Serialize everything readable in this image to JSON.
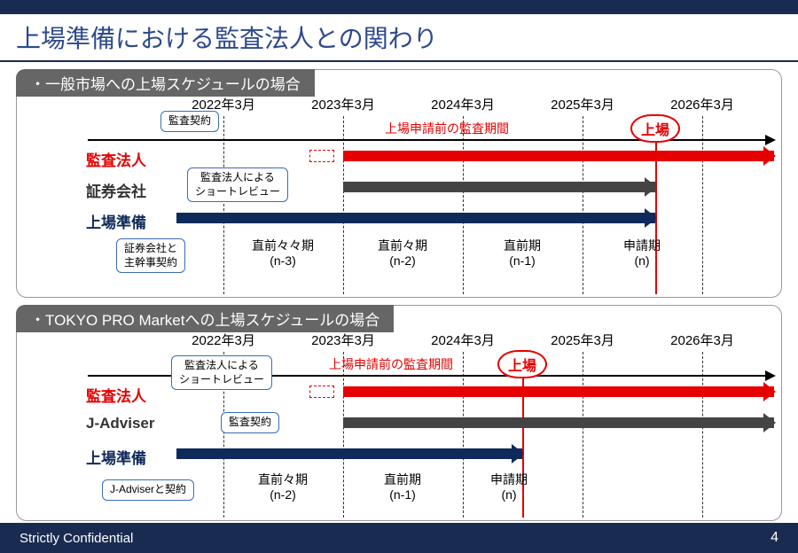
{
  "slide": {
    "title": "上場準備における監査法人との関わり"
  },
  "panel1": {
    "header": "・一般市場への上場スケジュールの場合",
    "years": [
      "2022年3月",
      "2023年3月",
      "2024年3月",
      "2025年3月",
      "2026年3月"
    ],
    "rows": {
      "r1": "監査法人",
      "r2": "証券会社",
      "r3": "上場準備"
    },
    "periods": [
      {
        "top": "直前々々期",
        "bot": "(n-3)"
      },
      {
        "top": "直前々期",
        "bot": "(n-2)"
      },
      {
        "top": "直前期",
        "bot": "(n-1)"
      },
      {
        "top": "申請期",
        "bot": "(n)"
      }
    ],
    "note": "上場申請前の監査期間",
    "listing": "上場",
    "callouts": {
      "c1": "監査契約",
      "c2": "監査法人による\nショートレビュー",
      "c3": "証券会社と\n主幹事契約"
    }
  },
  "panel2": {
    "header": "・TOKYO PRO Marketへの上場スケジュールの場合",
    "years": [
      "2022年3月",
      "2023年3月",
      "2024年3月",
      "2025年3月",
      "2026年3月"
    ],
    "rows": {
      "r1": "監査法人",
      "r2": "J-Adviser",
      "r3": "上場準備"
    },
    "periods": [
      {
        "top": "直前々期",
        "bot": "(n-2)"
      },
      {
        "top": "直前期",
        "bot": "(n-1)"
      },
      {
        "top": "申請期",
        "bot": "(n)"
      }
    ],
    "note": "上場申請前の監査期間",
    "listing": "上場",
    "callouts": {
      "c1": "監査法人による\nショートレビュー",
      "c2": "監査契約",
      "c3": "J-Adviserと契約"
    }
  },
  "footer": {
    "conf": "Strictly Confidential",
    "page": "4"
  },
  "chart_data": [
    {
      "type": "timeline",
      "title": "一般市場への上場スケジュールの場合",
      "x_ticks": [
        "2022年3月",
        "2023年3月",
        "2024年3月",
        "2025年3月",
        "2026年3月"
      ],
      "x_period_labels": [
        "直前々々期 (n-3)",
        "直前々期 (n-2)",
        "直前期 (n-1)",
        "申請期 (n)"
      ],
      "listing_event_at": "2025年3月後半",
      "series": [
        {
          "name": "監査法人",
          "start": "2023年3月",
          "end": "継続",
          "color": "#e60000",
          "note": "上場申請前の監査期間"
        },
        {
          "name": "証券会社",
          "start": "2023年3月",
          "end": "2025年3月後半",
          "color": "#444444"
        },
        {
          "name": "上場準備",
          "start": "2022年3月",
          "end": "2025年3月後半",
          "color": "#0f2a5a"
        }
      ],
      "annotations": [
        {
          "label": "監査契約",
          "target": "監査法人 2023年3月付近"
        },
        {
          "label": "監査法人によるショートレビュー",
          "target": "監査法人 2022年後半"
        },
        {
          "label": "証券会社と主幹事契約",
          "target": "証券会社 2022年前半"
        }
      ]
    },
    {
      "type": "timeline",
      "title": "TOKYO PRO Marketへの上場スケジュールの場合",
      "x_ticks": [
        "2022年3月",
        "2023年3月",
        "2024年3月",
        "2025年3月",
        "2026年3月"
      ],
      "x_period_labels": [
        "直前々期 (n-2)",
        "直前期 (n-1)",
        "申請期 (n)"
      ],
      "listing_event_at": "2024年3月後半",
      "series": [
        {
          "name": "監査法人",
          "start": "2023年3月",
          "end": "継続",
          "color": "#e60000",
          "note": "上場申請前の監査期間"
        },
        {
          "name": "J-Adviser",
          "start": "2023年3月",
          "end": "継続",
          "color": "#444444"
        },
        {
          "name": "上場準備",
          "start": "2022年3月",
          "end": "2024年3月後半",
          "color": "#0f2a5a"
        }
      ],
      "annotations": [
        {
          "label": "監査法人によるショートレビュー",
          "target": "監査法人 2022年後半"
        },
        {
          "label": "監査契約",
          "target": "監査法人 2023年前半"
        },
        {
          "label": "J-Adviserと契約",
          "target": "J-Adviser 2022年前半"
        }
      ]
    }
  ]
}
